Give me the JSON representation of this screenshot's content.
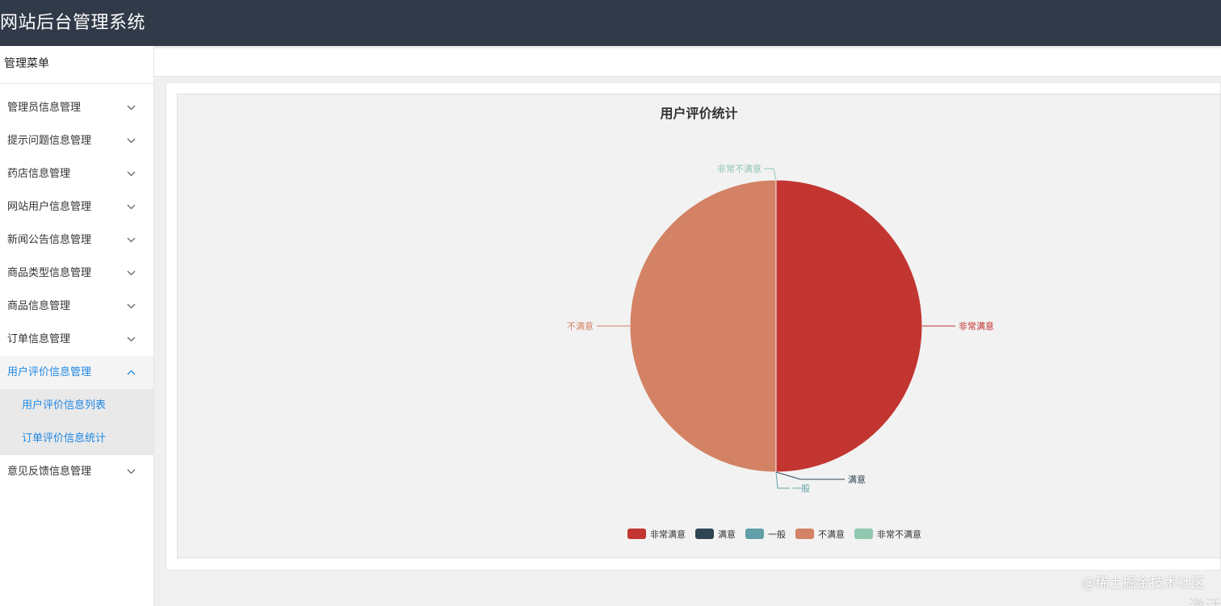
{
  "header": {
    "title": "网站后台管理系统"
  },
  "sidebar": {
    "title": "管理菜单",
    "items": [
      {
        "label": "管理员信息管理",
        "open": false
      },
      {
        "label": "提示问题信息管理",
        "open": false
      },
      {
        "label": "药店信息管理",
        "open": false
      },
      {
        "label": "网站用户信息管理",
        "open": false
      },
      {
        "label": "新闻公告信息管理",
        "open": false
      },
      {
        "label": "商品类型信息管理",
        "open": false
      },
      {
        "label": "商品信息管理",
        "open": false
      },
      {
        "label": "订单信息管理",
        "open": false
      },
      {
        "label": "用户评价信息管理",
        "open": true
      },
      {
        "label": "意见反馈信息管理",
        "open": false
      }
    ],
    "submenu": [
      "用户评价信息列表",
      "订单评价信息统计"
    ]
  },
  "colors": {
    "header_bg": "#313a48",
    "accent": "#1e88e5"
  },
  "chart_data": {
    "type": "pie",
    "title": "用户评价统计",
    "categories": [
      "非常满意",
      "满意",
      "一般",
      "不满意",
      "非常不满意"
    ],
    "values": [
      1,
      0,
      0,
      1,
      0
    ],
    "colors": [
      "#c23531",
      "#2f4554",
      "#61a0a8",
      "#d48265",
      "#91c7ae"
    ],
    "legend": "bottom-center"
  },
  "watermark": "@稀土掘金技术社区",
  "watermark2": "激活"
}
